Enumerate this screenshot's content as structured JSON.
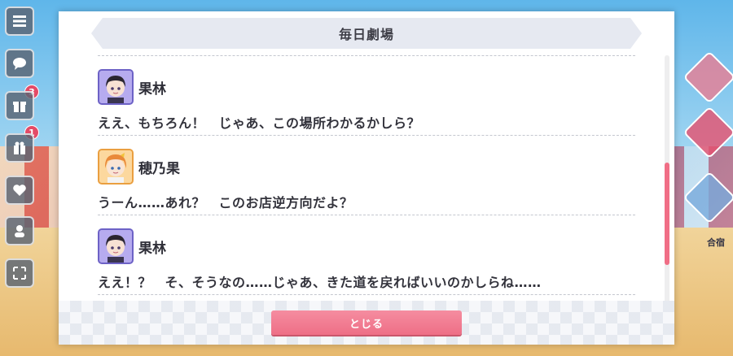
{
  "modal": {
    "title": "毎日劇場",
    "close_label": "とじる"
  },
  "dialogue": [
    {
      "speaker": "果林",
      "avatar": "karin-avatar",
      "line": "ええ、もちろん！　じゃあ、この場所わかるかしら？"
    },
    {
      "speaker": "穂乃果",
      "avatar": "honoka-avatar",
      "line": "うーん……あれ？　このお店逆方向だよ？"
    },
    {
      "speaker": "果林",
      "avatar": "karin-avatar",
      "line": "ええ！？　そ、そうなの……じゃあ、きた道を戻ればいいのかしらね……"
    }
  ],
  "background": {
    "badges": [
      "3",
      "1"
    ],
    "right_label": "合宿"
  },
  "colors": {
    "accent": "#ee6f86",
    "header_bg": "#e6e9f1",
    "text": "#33333c"
  }
}
